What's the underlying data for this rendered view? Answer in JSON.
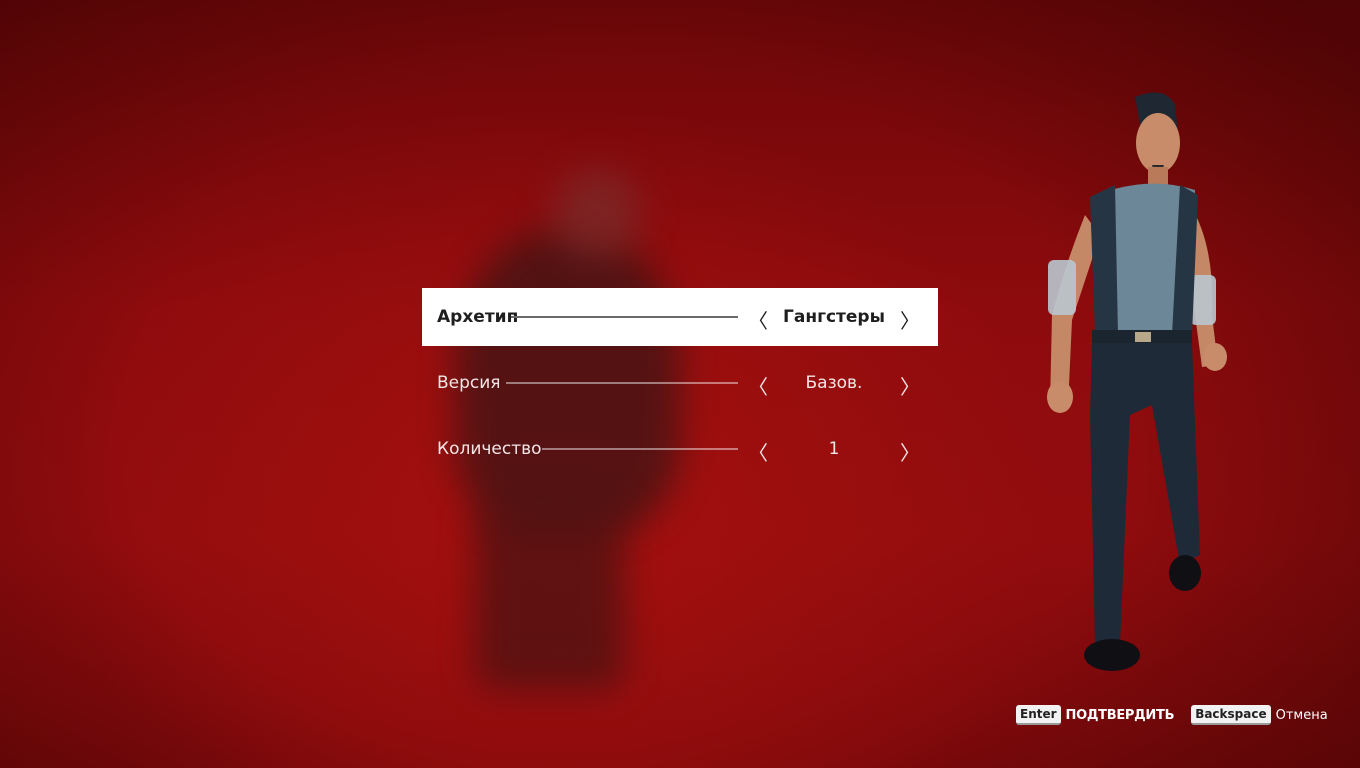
{
  "menu": {
    "rows": [
      {
        "label": "Архетип",
        "value": "Гангстеры",
        "prev": "〈",
        "next": "〉",
        "selected": true
      },
      {
        "label": "Версия",
        "value": "Базов.",
        "prev": "〈",
        "next": "〉",
        "selected": false
      },
      {
        "label": "Количество",
        "value": "1",
        "prev": "〈",
        "next": "〉",
        "selected": false
      }
    ]
  },
  "hints": {
    "confirm_key": "Enter",
    "confirm_label": "ПОДТВЕРДИТЬ",
    "cancel_key": "Backspace",
    "cancel_label": "Отмена"
  },
  "colors": {
    "background": "#8e0b0d",
    "selected_row": "#ffffff",
    "text": "#f3e6e6"
  }
}
